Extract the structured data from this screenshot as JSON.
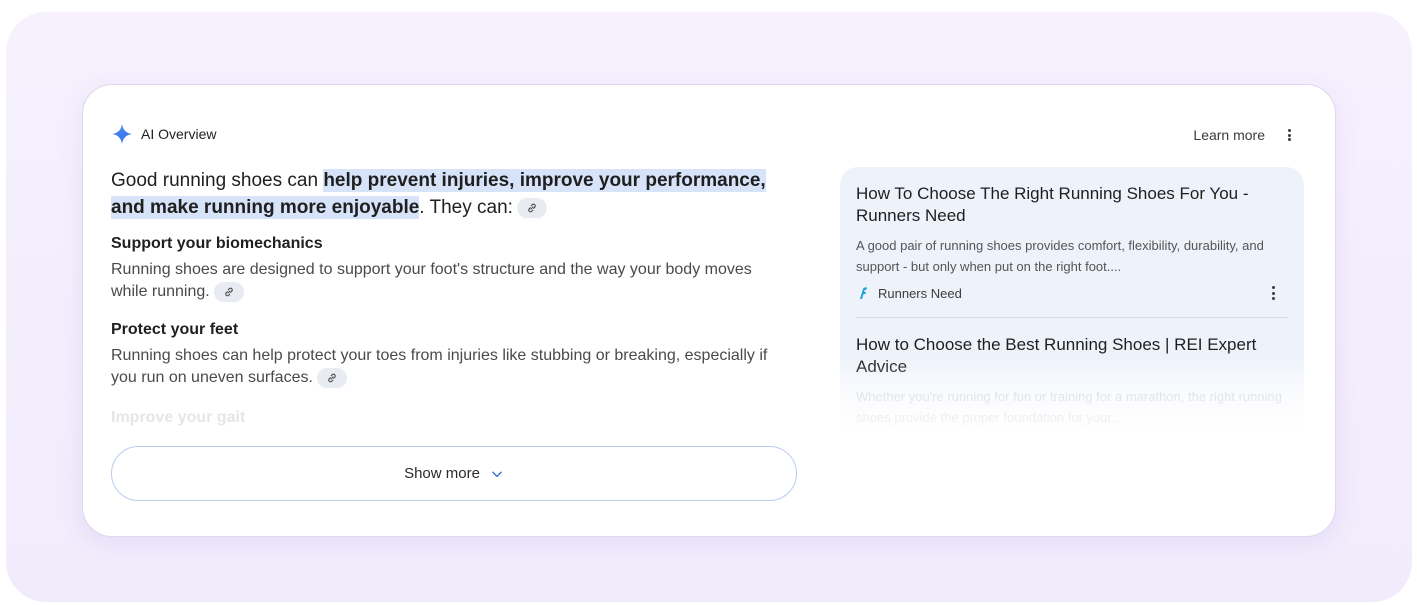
{
  "header": {
    "title": "AI Overview",
    "learn_more": "Learn more"
  },
  "overview": {
    "lead_before": "Good running shoes can ",
    "lead_highlight": "help prevent injuries, improve your performance, and make running more enjoyable",
    "lead_after": ". They can:",
    "sections": [
      {
        "title": "Support your biomechanics",
        "body": "Running shoes are designed to support your foot's structure and the way your body moves while running."
      },
      {
        "title": "Protect your feet",
        "body": "Running shoes can help protect your toes from injuries like stubbing or breaking, especially if you run on uneven surfaces."
      }
    ],
    "faded_title": "Improve your gait",
    "show_more": "Show more"
  },
  "sources": [
    {
      "title": "How To Choose The Right Running Shoes For You - Runners Need",
      "snippet": "A good pair of running shoes provides comfort, flexibility, durability, and support - but only when put on the right foot....",
      "site": "Runners Need"
    },
    {
      "title": "How to Choose the Best Running Shoes | REI Expert Advice",
      "snippet": "Whether you're running for fun or training for a marathon, the right running shoes provide the proper foundation for your..."
    }
  ],
  "colors": {
    "highlight": "#d6e3f8",
    "sparkle_blue": "#3b7cf0",
    "source_panel": "#eef2fb",
    "favicon": "#1a9fd8"
  }
}
